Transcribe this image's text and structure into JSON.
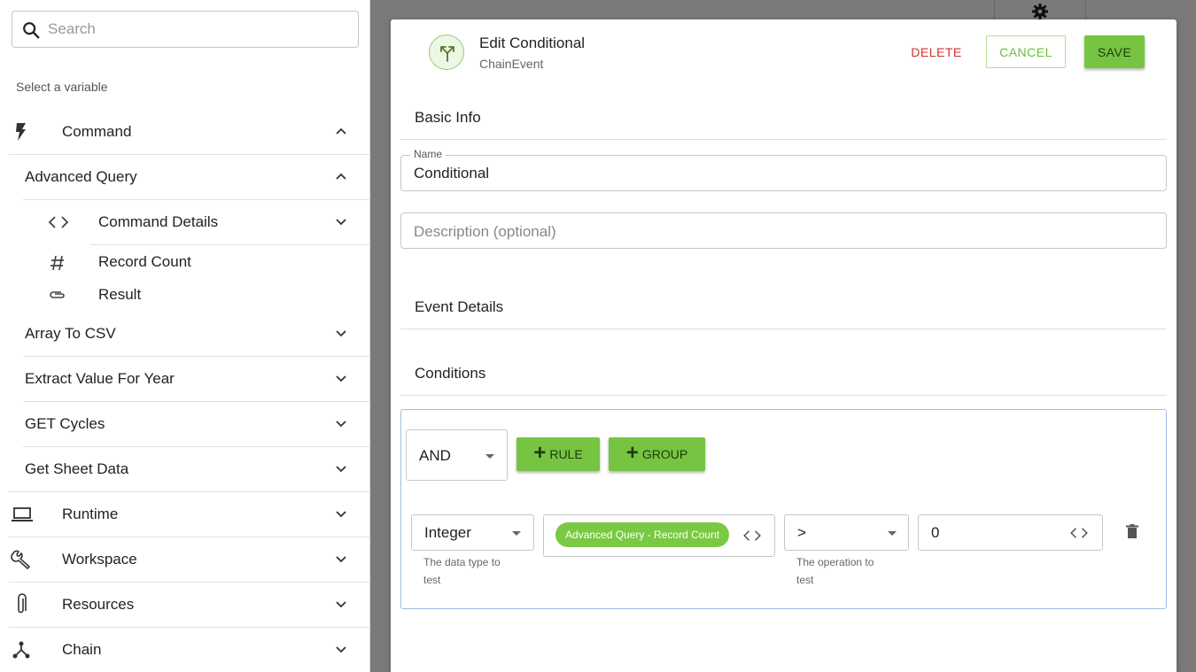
{
  "sidebar": {
    "search_placeholder": "Search",
    "select_label": "Select a variable",
    "command": "Command",
    "advanced_query": "Advanced Query",
    "command_details": "Command Details",
    "record_count": "Record Count",
    "result": "Result",
    "array_to_csv": "Array To CSV",
    "extract_value": "Extract Value For Year",
    "get_cycles": "GET Cycles",
    "get_sheet_data": "Get Sheet Data",
    "runtime": "Runtime",
    "workspace": "Workspace",
    "resources": "Resources",
    "chain": "Chain"
  },
  "dialog": {
    "title": "Edit Conditional",
    "subtitle": "ChainEvent",
    "delete_label": "DELETE",
    "cancel_label": "CANCEL",
    "save_label": "SAVE",
    "basic_info": "Basic Info",
    "name_label": "Name",
    "name_value": "Conditional",
    "description_placeholder": "Description (optional)",
    "event_details": "Event Details",
    "conditions": "Conditions",
    "group_operator": "AND",
    "rule_label": "RULE",
    "group_label": "GROUP",
    "rule": {
      "data_type": "Integer",
      "data_type_help_1": "The data type to",
      "data_type_help_2": "test",
      "variable_chip": "Advanced Query - Record Count",
      "operator": ">",
      "operator_help_1": "The operation to",
      "operator_help_2": "test",
      "value": "0"
    }
  },
  "colors": {
    "accent_green": "#76c442",
    "delete_red": "#d32f2f",
    "focus_blue": "#9dc0e8"
  }
}
